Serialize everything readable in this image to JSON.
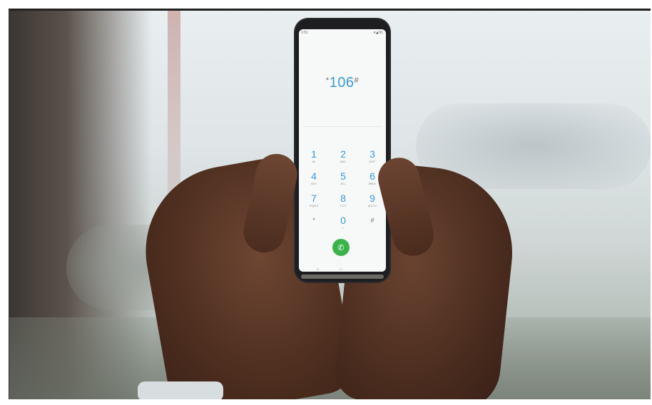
{
  "status_bar": {
    "time": "1:51",
    "indicators": "▾◢ 81"
  },
  "dialer": {
    "prefix": "*",
    "code": "106",
    "suffix": "#"
  },
  "keypad": [
    {
      "digit": "1",
      "letters": "ꝏ"
    },
    {
      "digit": "2",
      "letters": "ABC"
    },
    {
      "digit": "3",
      "letters": "DEF"
    },
    {
      "digit": "4",
      "letters": "GHI"
    },
    {
      "digit": "5",
      "letters": "JKL"
    },
    {
      "digit": "6",
      "letters": "MNO"
    },
    {
      "digit": "7",
      "letters": "PQRS"
    },
    {
      "digit": "8",
      "letters": "TUV"
    },
    {
      "digit": "9",
      "letters": "WXYZ"
    },
    {
      "digit": "*",
      "letters": ""
    },
    {
      "digit": "0",
      "letters": "+"
    },
    {
      "digit": "#",
      "letters": ""
    }
  ],
  "call_button_icon": "phone-icon",
  "colors": {
    "accent": "#3a9ad9",
    "call": "#3cb34a"
  }
}
